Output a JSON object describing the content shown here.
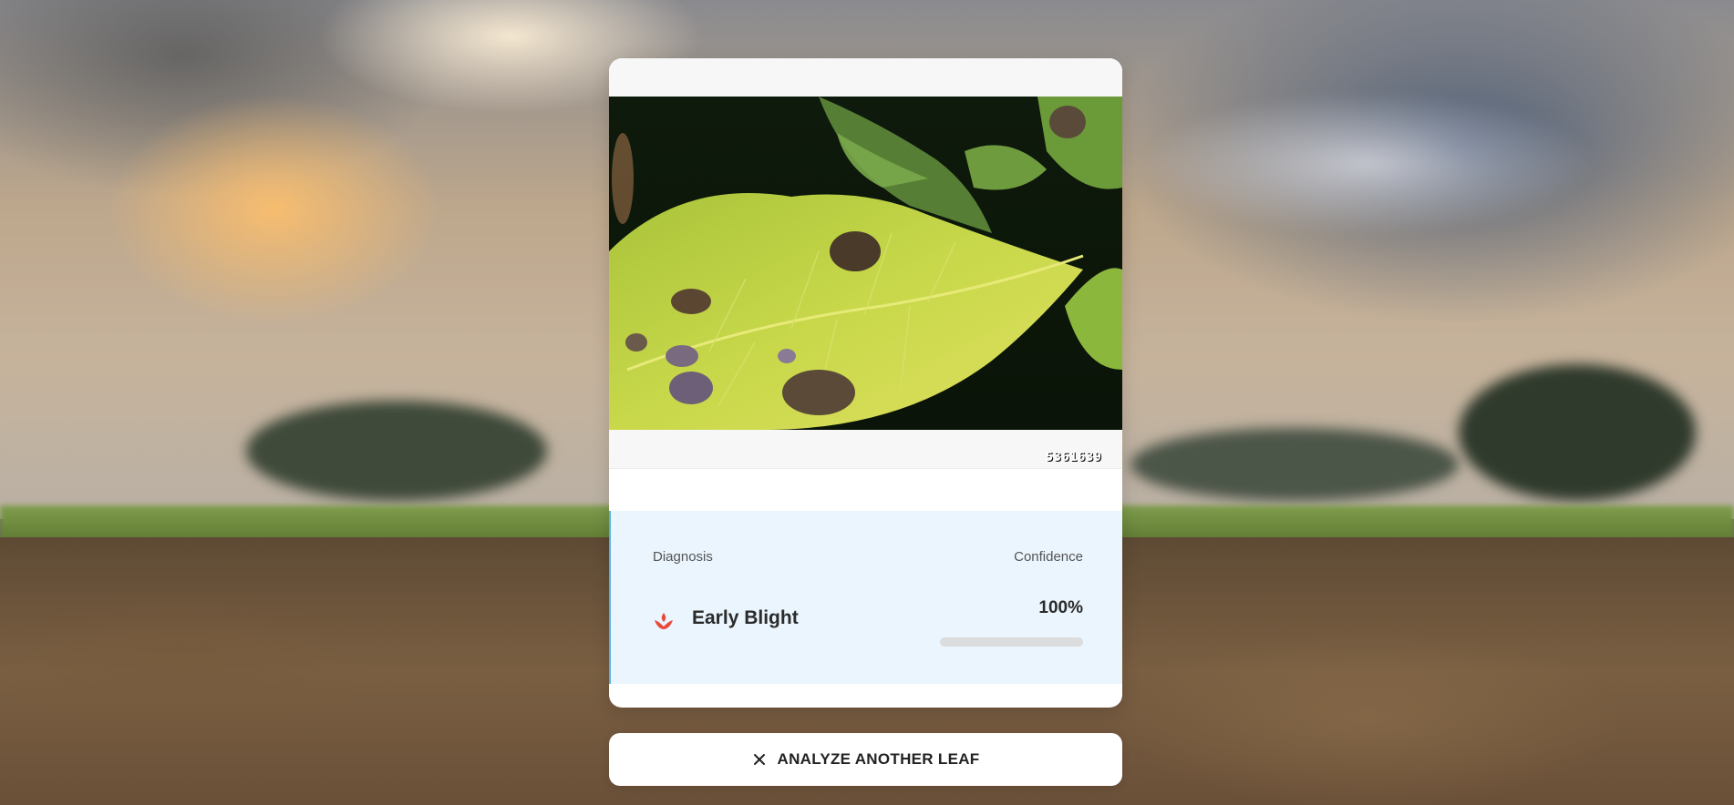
{
  "result": {
    "image_label": "5361639",
    "diagnosis_label": "Diagnosis",
    "confidence_label": "Confidence",
    "diagnosis_value": "Early Blight",
    "confidence_value": "100%",
    "confidence_fraction": 1.0,
    "diagnosis_icon": "flame-leaf-icon",
    "accent_color": "#e84b3c"
  },
  "actions": {
    "analyze_another_label": "ANALYZE ANOTHER LEAF",
    "analyze_another_icon": "close-icon"
  }
}
